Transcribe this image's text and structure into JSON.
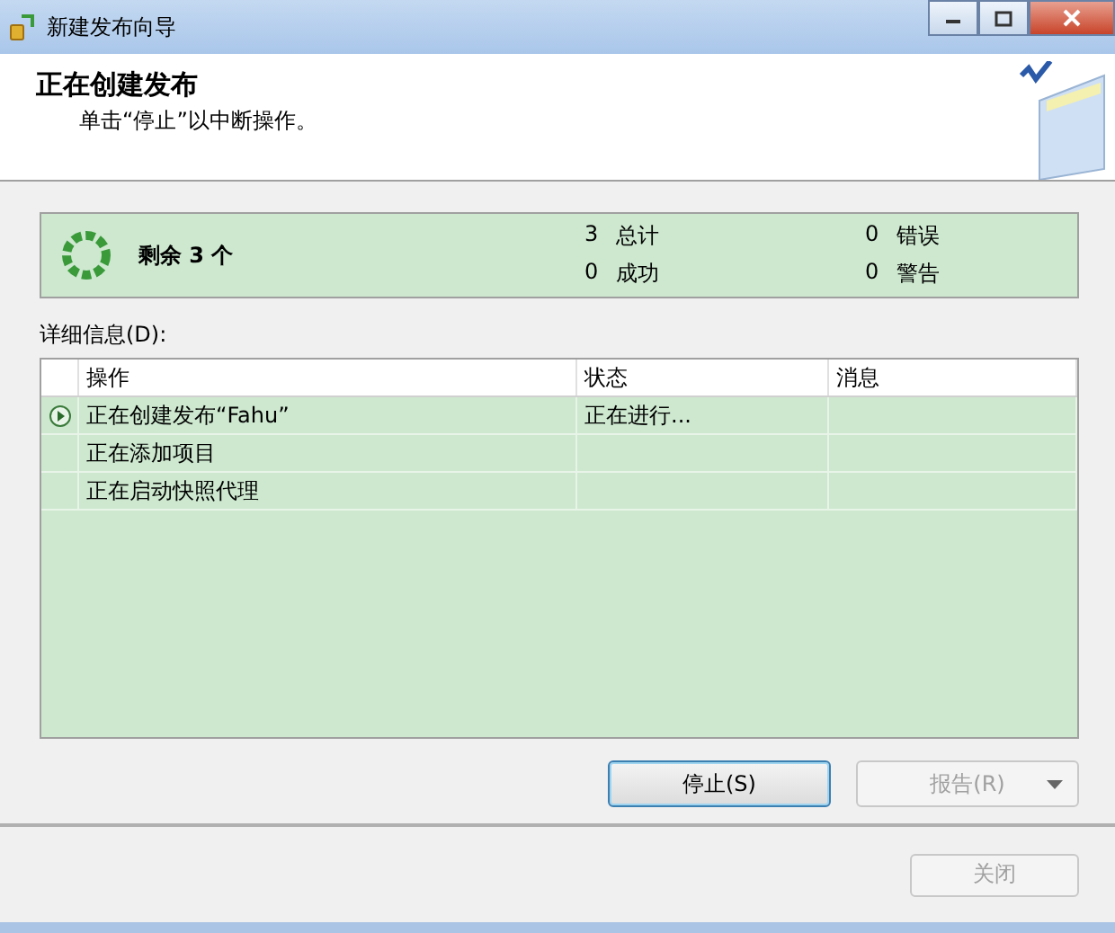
{
  "window": {
    "title": "新建发布向导"
  },
  "header": {
    "title": "正在创建发布",
    "subtitle": "单击“停止”以中断操作。"
  },
  "summary": {
    "remaining": "剩余 3 个",
    "stats": [
      {
        "count": "3",
        "label": "总计"
      },
      {
        "count": "0",
        "label": "错误"
      },
      {
        "count": "0",
        "label": "成功"
      },
      {
        "count": "0",
        "label": "警告"
      }
    ]
  },
  "details_label": "详细信息(D):",
  "table": {
    "columns": [
      "操作",
      "状态",
      "消息"
    ],
    "rows": [
      {
        "action": "正在创建发布“Fahu”",
        "status": "正在进行...",
        "current": true
      },
      {
        "action": "正在添加项目",
        "current": false
      },
      {
        "action": "正在启动快照代理",
        "current": false
      }
    ]
  },
  "buttons": [
    {
      "label": "停止(S)",
      "kind": "default",
      "disabled": false
    },
    {
      "label": "报告(R)",
      "kind": "dropdown",
      "disabled": true
    }
  ],
  "footer_button": {
    "label": "关闭",
    "disabled": true
  }
}
